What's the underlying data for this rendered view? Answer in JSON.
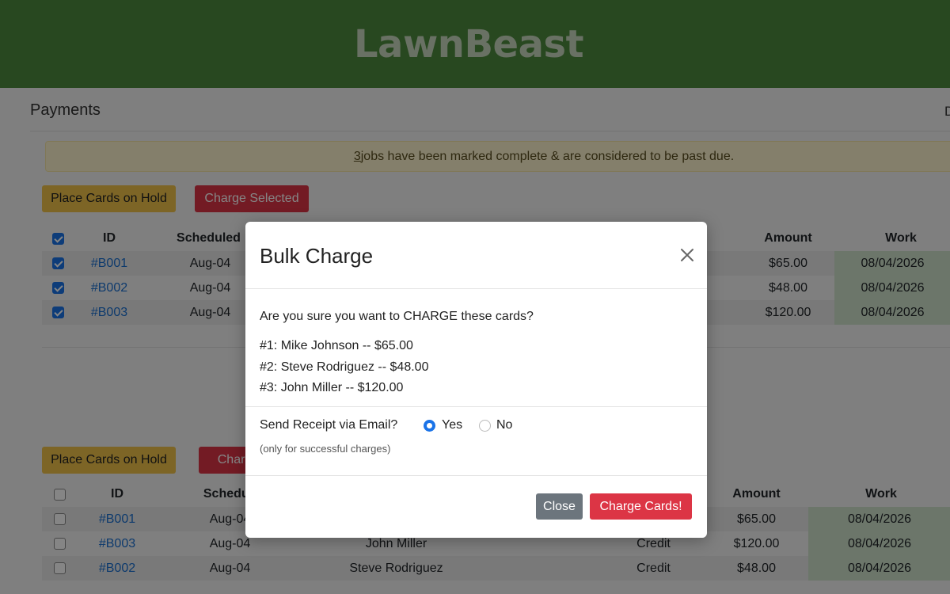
{
  "header": {
    "brand": "LawnBeast"
  },
  "page": {
    "title": "Payments",
    "right_text": "D"
  },
  "alert": {
    "count": "3",
    "message": " jobs have been marked complete & are considered to be past due."
  },
  "actions": {
    "hold_label": "Place Cards on Hold",
    "charge_label": "Charge Selected"
  },
  "table1": {
    "headers": {
      "id": "ID",
      "scheduled": "Scheduled",
      "amount": "Amount",
      "work": "Work"
    },
    "rows": [
      {
        "id": "#B001",
        "scheduled": "Aug-04",
        "amount": "$65.00",
        "work": "08/04/2026",
        "checked": true
      },
      {
        "id": "#B002",
        "scheduled": "Aug-04",
        "amount": "$48.00",
        "work": "08/04/2026",
        "checked": true
      },
      {
        "id": "#B003",
        "scheduled": "Aug-04",
        "amount": "$120.00",
        "work": "08/04/2026",
        "checked": true
      }
    ]
  },
  "actions2": {
    "hold_label": "Place Cards on Hold",
    "charge_label": "Charge"
  },
  "table2": {
    "headers": {
      "id": "ID",
      "scheduled": "Schedul",
      "amount": "Amount",
      "work": "Work"
    },
    "rows": [
      {
        "id": "#B001",
        "scheduled": "Aug-04",
        "customer": "",
        "payment": "",
        "amount": "$65.00",
        "work": "08/04/2026",
        "checked": false
      },
      {
        "id": "#B003",
        "scheduled": "Aug-04",
        "customer": "John Miller",
        "payment": "Credit",
        "amount": "$120.00",
        "work": "08/04/2026",
        "checked": false
      },
      {
        "id": "#B002",
        "scheduled": "Aug-04",
        "customer": "Steve Rodriguez",
        "payment": "Credit",
        "amount": "$48.00",
        "work": "08/04/2026",
        "checked": false
      }
    ]
  },
  "modal": {
    "title": "Bulk Charge",
    "question": "Are you sure you want to CHARGE these cards?",
    "charges": [
      "#1: Mike Johnson -- $65.00",
      "#2: Steve Rodriguez -- $48.00",
      "#3: John Miller -- $120.00"
    ],
    "receipt_label": "Send Receipt via Email?",
    "yes_label": "Yes",
    "no_label": "No",
    "receipt_selected": "Yes",
    "receipt_note": "(only for successful charges)",
    "close_label": "Close",
    "confirm_label": "Charge Cards!"
  }
}
